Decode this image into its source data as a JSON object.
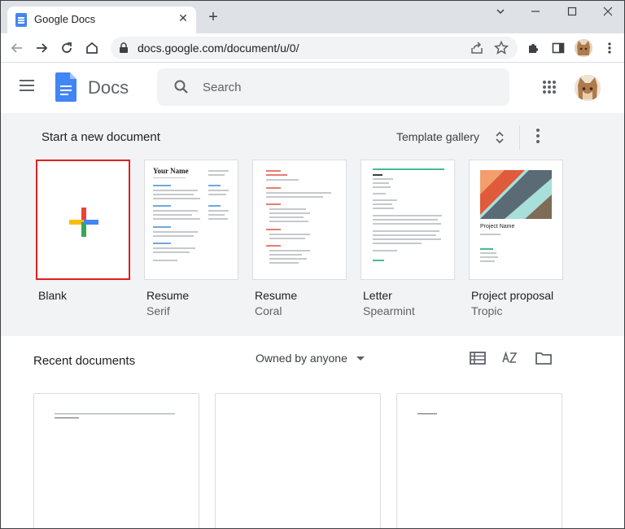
{
  "browser": {
    "tab_title": "Google Docs",
    "url": "docs.google.com/document/u/0/"
  },
  "header": {
    "app_name": "Docs",
    "search_placeholder": "Search"
  },
  "templates": {
    "section_title": "Start a new document",
    "gallery_label": "Template gallery",
    "items": [
      {
        "name": "Blank",
        "sub": ""
      },
      {
        "name": "Resume",
        "sub": "Serif"
      },
      {
        "name": "Resume",
        "sub": "Coral"
      },
      {
        "name": "Letter",
        "sub": "Spearmint"
      },
      {
        "name": "Project proposal",
        "sub": "Tropic"
      }
    ],
    "resume_serif_heading": "Your Name",
    "proposal_heading": "Project Name"
  },
  "recent": {
    "title": "Recent documents",
    "owner_filter": "Owned by anyone"
  },
  "colors": {
    "docs_blue": "#4285f4",
    "selection_border": "#e11f1f",
    "section_bg": "#f1f3f4"
  }
}
